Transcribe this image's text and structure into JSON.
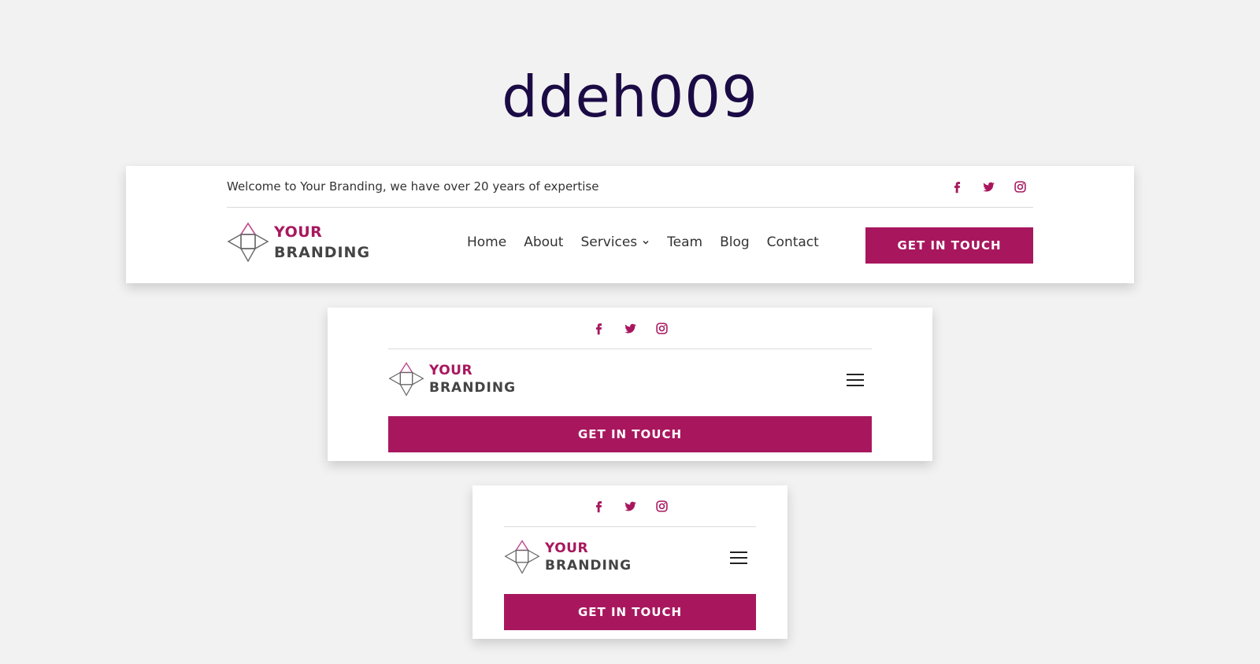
{
  "page": {
    "title": "ddeh009"
  },
  "brand": {
    "line1": "YOUR",
    "line2": "BRANDING",
    "accent": "#a8175e",
    "text": "#444444"
  },
  "topbar": {
    "welcome": "Welcome to Your Branding, we have over 20 years of expertise"
  },
  "socials": [
    "facebook-icon",
    "twitter-icon",
    "instagram-icon"
  ],
  "nav": {
    "home": "Home",
    "about": "About",
    "services": "Services",
    "team": "Team",
    "blog": "Blog",
    "contact": "Contact"
  },
  "cta": {
    "label": "GET IN TOUCH"
  },
  "colors": {
    "background": "#f2f2f2",
    "title": "#1b0b45",
    "cta": "#a8175e"
  }
}
